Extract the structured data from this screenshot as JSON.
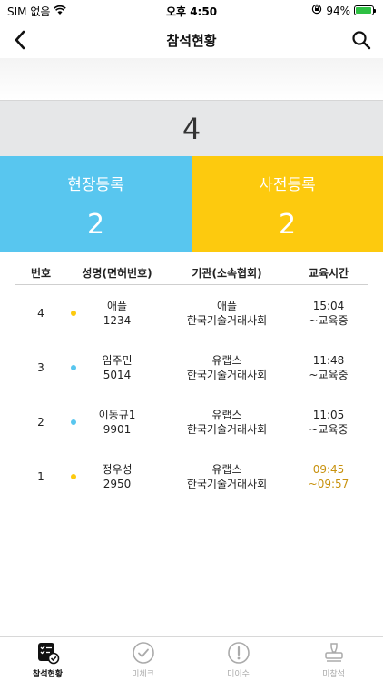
{
  "status_bar": {
    "carrier": "SIM 없음",
    "time": "오후 4:50",
    "battery_percent": "94%",
    "battery_level": 0.94
  },
  "nav": {
    "title": "참석현황"
  },
  "summary": {
    "total": "4",
    "onsite_label": "현장등록",
    "onsite_count": "2",
    "pre_label": "사전등록",
    "pre_count": "2"
  },
  "table": {
    "headers": {
      "num": "번호",
      "name": "성명(면허번호)",
      "org": "기관(소속협회)",
      "time": "교육시간"
    },
    "rows": [
      {
        "num": "4",
        "dot_color": "#fdca0e",
        "name": "애플",
        "license": "1234",
        "org": "애플",
        "association": "한국기술거래사회",
        "start": "15:04",
        "end": "~교육중",
        "time_color": "#222222"
      },
      {
        "num": "3",
        "dot_color": "#58c6ef",
        "name": "임주민",
        "license": "5014",
        "org": "유랩스",
        "association": "한국기술거래사회",
        "start": "11:48",
        "end": "~교육중",
        "time_color": "#222222"
      },
      {
        "num": "2",
        "dot_color": "#58c6ef",
        "name": "이동규1",
        "license": "9901",
        "org": "유랩스",
        "association": "한국기술거래사회",
        "start": "11:05",
        "end": "~교육중",
        "time_color": "#222222"
      },
      {
        "num": "1",
        "dot_color": "#fdca0e",
        "name": "정우성",
        "license": "2950",
        "org": "유랩스",
        "association": "한국기술거래사회",
        "start": "09:45",
        "end": "~09:57",
        "time_color": "#c8920f"
      }
    ]
  },
  "tabs": [
    {
      "label": "참석현황",
      "icon": "checklist-icon",
      "active": true
    },
    {
      "label": "미체크",
      "icon": "check-circle-icon",
      "active": false
    },
    {
      "label": "미이수",
      "icon": "exclamation-circle-icon",
      "active": false
    },
    {
      "label": "미참석",
      "icon": "stamp-icon",
      "active": false
    }
  ],
  "colors": {
    "onsite": "#58c6ef",
    "pre": "#fdca0e",
    "total_bg": "#e6e7e8",
    "completed_time": "#c8920f"
  }
}
